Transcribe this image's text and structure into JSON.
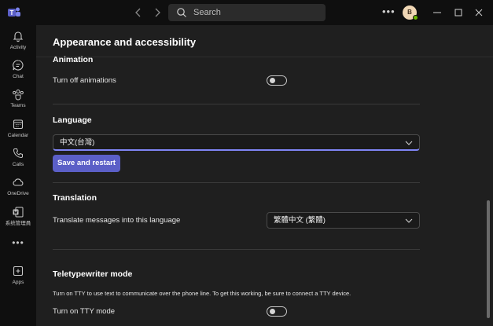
{
  "titlebar": {
    "search_placeholder": "Search",
    "avatar_initial": "B",
    "more_label": "•••"
  },
  "rail": {
    "items": [
      {
        "label": "Activity",
        "icon": "bell-icon"
      },
      {
        "label": "Chat",
        "icon": "chat-icon"
      },
      {
        "label": "Teams",
        "icon": "teams-icon"
      },
      {
        "label": "Calendar",
        "icon": "calendar-icon"
      },
      {
        "label": "Calls",
        "icon": "phone-icon"
      },
      {
        "label": "OneDrive",
        "icon": "cloud-icon"
      },
      {
        "label": "系统管理員",
        "icon": "app-icon"
      },
      {
        "label": "Apps",
        "icon": "plus-square-icon"
      }
    ],
    "more_label": "•••"
  },
  "main": {
    "title": "Appearance and accessibility",
    "animation": {
      "title": "Animation",
      "toggle_label": "Turn off animations",
      "toggle_on": false
    },
    "language": {
      "title": "Language",
      "selected": "中文(台灣)",
      "button": "Save and restart"
    },
    "translation": {
      "title": "Translation",
      "label": "Translate messages into this language",
      "selected": "繁體中文 (繁體)"
    },
    "tty": {
      "title": "Teletypewriter mode",
      "description": "Turn on TTY to use text to communicate over the phone line. To get this working, be sure to connect a TTY device.",
      "toggle_label": "Turn on TTY mode",
      "toggle_on": false
    }
  },
  "colors": {
    "accent": "#5b5fc7",
    "focus_underline": "#7f85f5",
    "background": "#1f1f1f",
    "titlebar": "#0f0f0f",
    "presence": "#6bb700"
  }
}
